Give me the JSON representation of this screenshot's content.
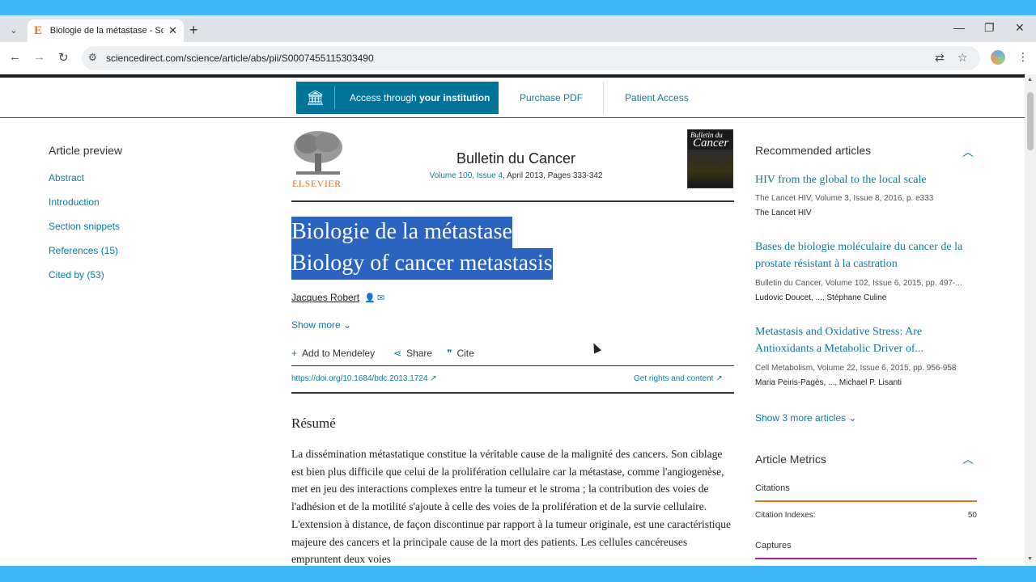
{
  "browser": {
    "tab_title": "Biologie de la métastase - Scien",
    "tab_favicon": "E",
    "url": "sciencedirect.com/science/article/abs/pii/S0007455115303490"
  },
  "access": {
    "institution_prefix": "Access through",
    "institution_bold": "your institution",
    "purchase_pdf": "Purchase PDF",
    "patient_access": "Patient Access"
  },
  "sidebar": {
    "title": "Article preview",
    "items": [
      "Abstract",
      "Introduction",
      "Section snippets",
      "References (15)",
      "Cited by (53)"
    ]
  },
  "header": {
    "publisher": "ELSEVIER",
    "journal": "Bulletin du Cancer",
    "volume_link": "Volume 100, Issue 4",
    "volume_rest": ", April 2013, Pages 333-342",
    "cover_small": "Bulletin du",
    "cover_big": "Cancer"
  },
  "article": {
    "title_fr": "Biologie de la métastase",
    "title_en": "Biology of cancer metastasis",
    "author": "Jacques Robert",
    "show_more": "Show more",
    "add_mendeley": "Add to Mendeley",
    "share": "Share",
    "cite": "Cite",
    "doi": "https://doi.org/10.1684/bdc.2013.1724",
    "rights": "Get rights and content",
    "resume_heading": "Résumé",
    "abstract_text": "La dissémination métastatique constitue la véritable cause de la malignité des cancers. Son ciblage est bien plus difficile que celui de la prolifération cellulaire car la métastase, comme l'angiogenèse, met en jeu des interactions complexes entre la tumeur et le stroma ; la contribution des voies de l'adhésion et de la motilité s'ajoute à celle des voies de la prolifération et de la survie cellulaire. L'extension à distance, de façon discontinue par rapport à la tumeur originale, est une caractéristique majeure des cancers et la principale cause de la mort des patients. Les cellules cancéreuses empruntent deux voies"
  },
  "recommended": {
    "title": "Recommended articles",
    "articles": [
      {
        "title": "HIV from the global to the local scale",
        "meta": "The Lancet HIV, Volume 3, Issue 8, 2016, p. e333",
        "authors": "The Lancet HIV"
      },
      {
        "title": "Bases de biologie moléculaire du cancer de la prostate résistant à la castration",
        "meta": "Bulletin du Cancer, Volume 102, Issue 6, 2015, pp. 497-...",
        "authors": "Ludovic Doucet, ..., Stéphane Culine"
      },
      {
        "title": "Metastasis and Oxidative Stress: Are Antioxidants a Metabolic Driver of...",
        "meta": "Cell Metabolism, Volume 22, Issue 6, 2015, pp. 956-958",
        "authors": "Maria Peiris-Pagès, ..., Michael P. Lisanti"
      }
    ],
    "show_more": "Show 3 more articles"
  },
  "metrics": {
    "title": "Article Metrics",
    "citations_label": "Citations",
    "citation_indexes_label": "Citation Indexes:",
    "citation_indexes_value": "50",
    "captures_label": "Captures"
  },
  "colors": {
    "accent": "#0c7d9f",
    "institution_button": "#007398",
    "selection": "#2b63c1",
    "elsevier_orange": "#e9711c",
    "citations_bar": "#e9711c",
    "captures_bar": "#b1208c"
  }
}
